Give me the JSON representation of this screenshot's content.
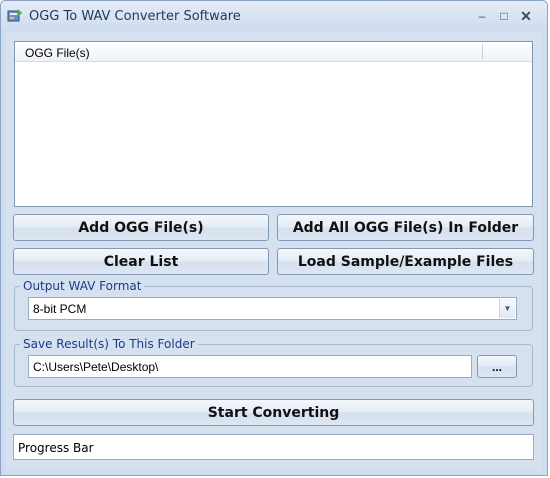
{
  "window": {
    "title": "OGG To WAV Converter Software",
    "controls": {
      "minimize": "–",
      "maximize": "□",
      "close": "✕"
    }
  },
  "file_list": {
    "columns": [
      "OGG File(s)"
    ],
    "rows": []
  },
  "buttons": {
    "add_files": "Add OGG File(s)",
    "add_folder": "Add All OGG File(s) In Folder",
    "clear_list": "Clear List",
    "load_samples": "Load Sample/Example Files",
    "start": "Start Converting",
    "browse": "..."
  },
  "output_format": {
    "legend": "Output WAV Format",
    "selected": "8-bit PCM"
  },
  "save_folder": {
    "legend": "Save Result(s) To This Folder",
    "value": "C:\\Users\\Pete\\Desktop\\"
  },
  "progress": {
    "label": "Progress Bar"
  },
  "colors": {
    "accent": "#1a3c8a",
    "background": "#d6e1f0",
    "border": "#8498b6"
  }
}
